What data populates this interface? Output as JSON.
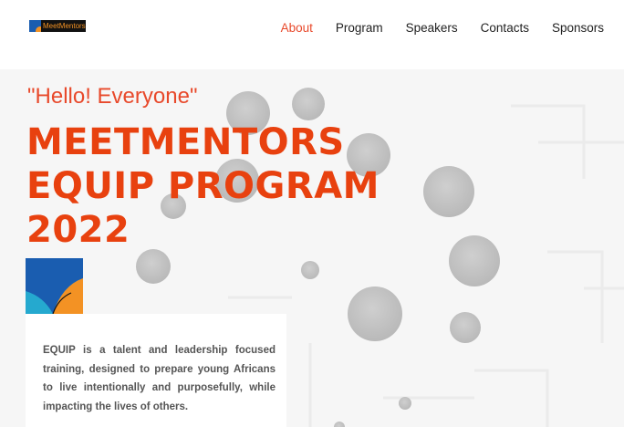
{
  "header": {
    "logo_text": "MeetMentors",
    "nav": [
      {
        "label": "About",
        "active": true
      },
      {
        "label": "Program",
        "active": false
      },
      {
        "label": "Speakers",
        "active": false
      },
      {
        "label": "Contacts",
        "active": false
      },
      {
        "label": "Sponsors",
        "active": false
      }
    ]
  },
  "hero": {
    "greeting": "\"Hello! Everyone\"",
    "title_lines": [
      "MEETMENTORS",
      "EQUIP PROGRAM",
      "2022"
    ],
    "description": "EQUIP is a talent and leadership focused training, designed to prepare young Africans to live intentionally and purposefully, while impacting the lives of others."
  },
  "colors": {
    "accent": "#e8492b",
    "title": "#e8410f",
    "badge_blue": "#1a5db0",
    "badge_cyan": "#25a9cf",
    "badge_orange": "#f39224"
  }
}
